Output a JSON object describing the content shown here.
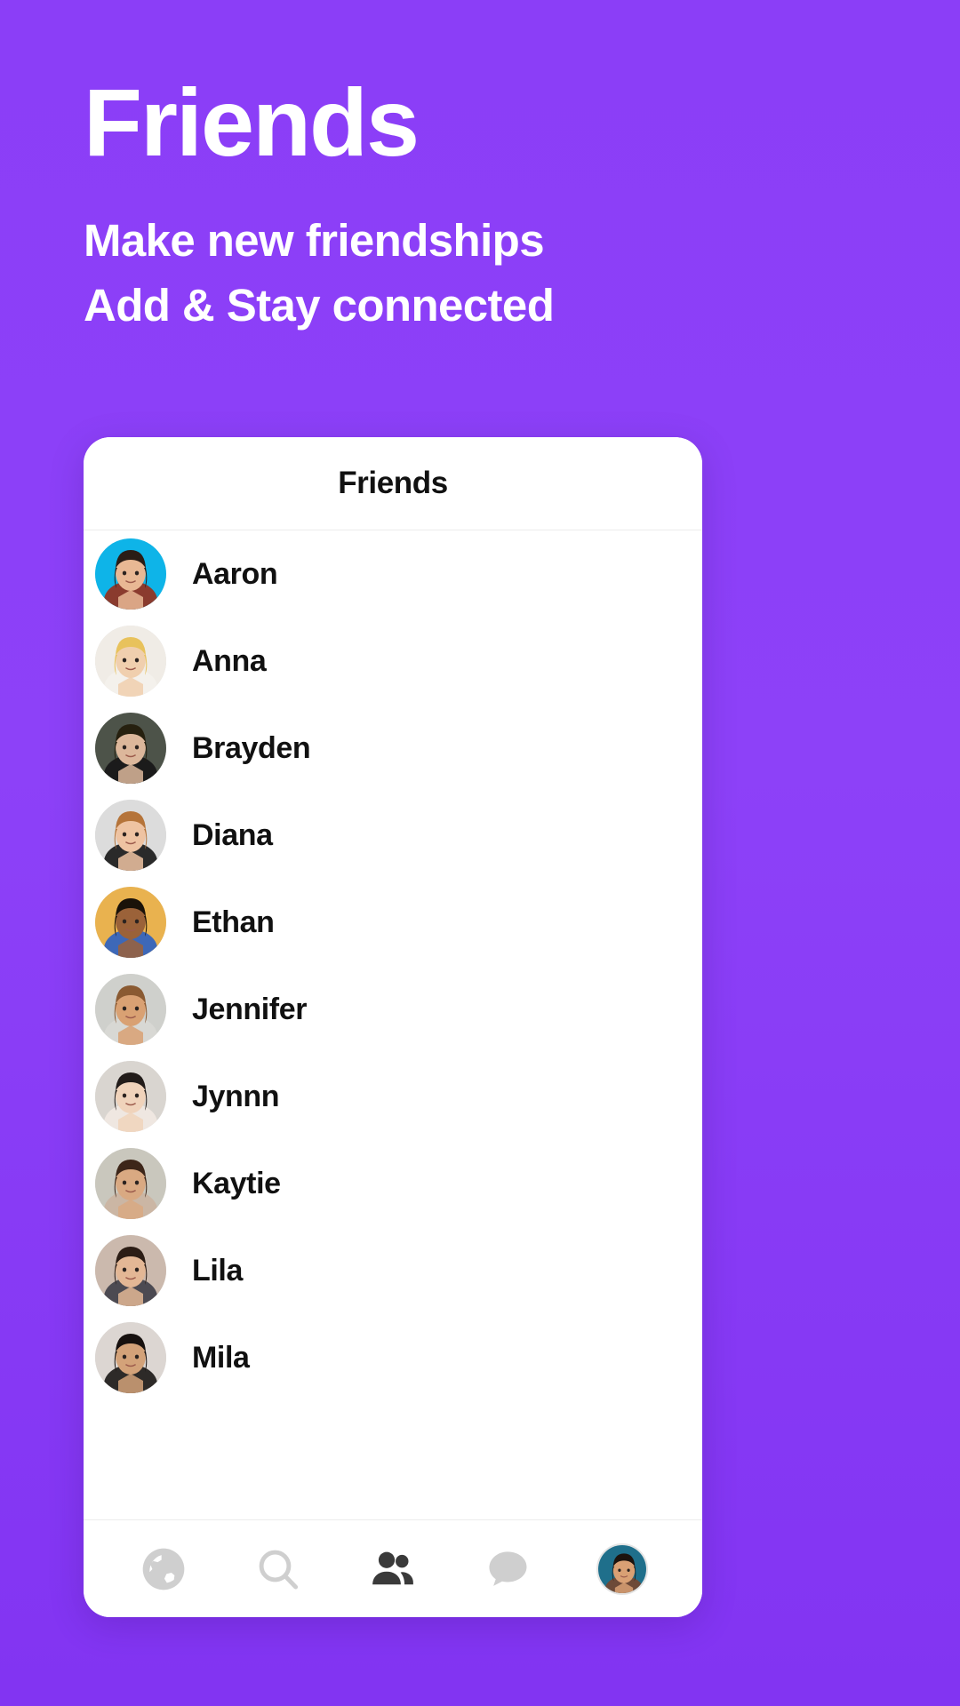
{
  "promo": {
    "title": "Friends",
    "subtitle_line1": "Make new friendships",
    "subtitle_line2": "Add & Stay connected",
    "background_color": "#8b3ef7",
    "text_color": "#ffffff"
  },
  "app": {
    "header_title": "Friends",
    "friends": [
      {
        "name": "Aaron",
        "avatar_name": "avatar-aaron",
        "bg": "#0eb4e8",
        "skin": "#e8b894",
        "hair": "#2a1d16",
        "cloth": "#8a3b2e"
      },
      {
        "name": "Anna",
        "avatar_name": "avatar-anna",
        "bg": "#f0ece6",
        "skin": "#f0cfae",
        "hair": "#e8c25c",
        "cloth": "#f4f1ec"
      },
      {
        "name": "Brayden",
        "avatar_name": "avatar-brayden",
        "bg": "#4d5349",
        "skin": "#dcb79b",
        "hair": "#26200f",
        "cloth": "#1b1b1b"
      },
      {
        "name": "Diana",
        "avatar_name": "avatar-diana",
        "bg": "#dcdcdc",
        "skin": "#eec3a2",
        "hair": "#b5743a",
        "cloth": "#2a2a2a"
      },
      {
        "name": "Ethan",
        "avatar_name": "avatar-ethan",
        "bg": "#e9b24f",
        "skin": "#9b6239",
        "hair": "#1a1209",
        "cloth": "#3d68b8"
      },
      {
        "name": "Jennifer",
        "avatar_name": "avatar-jennifer",
        "bg": "#cfd0cc",
        "skin": "#d9a173",
        "hair": "#8a5a32",
        "cloth": "#d8d8d4"
      },
      {
        "name": "Jynnn",
        "avatar_name": "avatar-jynnn",
        "bg": "#d9d5d0",
        "skin": "#f0d3bb",
        "hair": "#221c1a",
        "cloth": "#efe7e1"
      },
      {
        "name": "Kaytie",
        "avatar_name": "avatar-kaytie",
        "bg": "#c9c7bd",
        "skin": "#d9a982",
        "hair": "#3d2619",
        "cloth": "#cbb6a4"
      },
      {
        "name": "Lila",
        "avatar_name": "avatar-lila",
        "bg": "#cbb9ad",
        "skin": "#e3b795",
        "hair": "#2c1d15",
        "cloth": "#4c4a52"
      },
      {
        "name": "Mila",
        "avatar_name": "avatar-mila",
        "bg": "#dcd6d2",
        "skin": "#d3a279",
        "hair": "#17110f",
        "cloth": "#2d2a28"
      }
    ],
    "bottom_nav": [
      {
        "icon": "globe-icon",
        "label": "Discover",
        "active": false
      },
      {
        "icon": "search-icon",
        "label": "Search",
        "active": false
      },
      {
        "icon": "people-icon",
        "label": "Friends",
        "active": true
      },
      {
        "icon": "chat-icon",
        "label": "Chats",
        "active": false
      },
      {
        "icon": "profile-avatar-icon",
        "label": "Profile",
        "active": false
      }
    ],
    "nav_inactive_color": "#cfcfcf",
    "nav_active_color": "#3a3a3a"
  }
}
